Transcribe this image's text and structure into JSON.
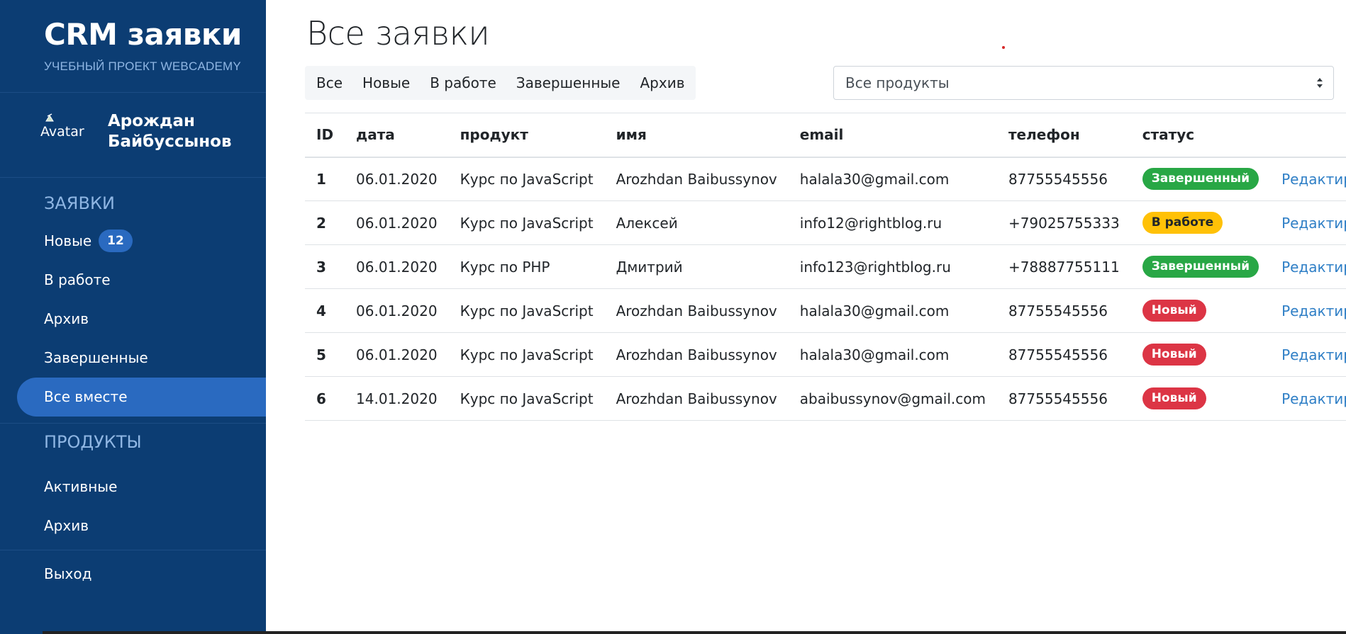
{
  "sidebar": {
    "brand_title": "CRM заявки",
    "brand_sub": "УЧЕБНЫЙ ПРОЕКТ WEBCADEMY",
    "avatar_alt": "Avatar",
    "user_name": "Арождан Байбуссынов",
    "section_requests": "ЗАЯВКИ",
    "items": [
      {
        "label": "Новые",
        "badge": "12"
      },
      {
        "label": "В работе"
      },
      {
        "label": "Архив"
      },
      {
        "label": "Завершенные"
      },
      {
        "label": "Все вместе",
        "active": true
      }
    ],
    "section_products": "ПРОДУКТЫ",
    "product_items": [
      {
        "label": "Активные"
      },
      {
        "label": "Архив"
      }
    ],
    "logout": "Выход"
  },
  "main": {
    "title": "Все заявки",
    "filter_tabs": [
      "Все",
      "Новые",
      "В работе",
      "Завершенные",
      "Архив"
    ],
    "product_select": "Все продукты"
  },
  "table": {
    "headers": [
      "ID",
      "дата",
      "продукт",
      "имя",
      "email",
      "телефон",
      "статус",
      ""
    ],
    "rows": [
      {
        "id": "1",
        "date": "06.01.2020",
        "product": "Курс по JavaScript",
        "name": "Arozhdan Baibussynov",
        "email": "halala30@gmail.com",
        "phone": "87755545556",
        "status": "Завершенный",
        "status_type": "done",
        "action": "Редактировать"
      },
      {
        "id": "2",
        "date": "06.01.2020",
        "product": "Курс по JavaScript",
        "name": "Алексей",
        "email": "info12@rightblog.ru",
        "phone": "+79025755333",
        "status": "В работе",
        "status_type": "work",
        "action": "Редактировать"
      },
      {
        "id": "3",
        "date": "06.01.2020",
        "product": "Курс по PHP",
        "name": "Дмитрий",
        "email": "info123@rightblog.ru",
        "phone": "+78887755111",
        "status": "Завершенный",
        "status_type": "done",
        "action": "Редактировать"
      },
      {
        "id": "4",
        "date": "06.01.2020",
        "product": "Курс по JavaScript",
        "name": "Arozhdan Baibussynov",
        "email": "halala30@gmail.com",
        "phone": "87755545556",
        "status": "Новый",
        "status_type": "new",
        "action": "Редактировать"
      },
      {
        "id": "5",
        "date": "06.01.2020",
        "product": "Курс по JavaScript",
        "name": "Arozhdan Baibussynov",
        "email": "halala30@gmail.com",
        "phone": "87755545556",
        "status": "Новый",
        "status_type": "new",
        "action": "Редактировать"
      },
      {
        "id": "6",
        "date": "14.01.2020",
        "product": "Курс по JavaScript",
        "name": "Arozhdan Baibussynov",
        "email": "abaibussynov@gmail.com",
        "phone": "87755545556",
        "status": "Новый",
        "status_type": "new",
        "action": "Редактировать"
      }
    ]
  },
  "colors": {
    "sidebar_bg": "#0c3d73",
    "accent": "#2a6ac0",
    "status_done": "#28a745",
    "status_work": "#ffc107",
    "status_new": "#dc3545",
    "link": "#2f7fc6"
  },
  "icons": {
    "avatar": "broken-image-icon",
    "select": "select-arrows-icon"
  }
}
